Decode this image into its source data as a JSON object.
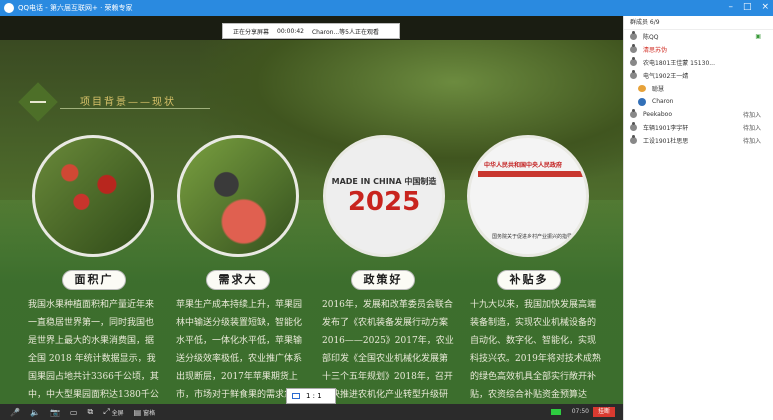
{
  "window": {
    "title": "QQ电话 - 第六届互联网+ · 荣赖专家"
  },
  "sharebar": {
    "status": "正在分享屏幕",
    "time": "00:00:42",
    "viewers": "Charon...等5人正在观看"
  },
  "slide": {
    "heading": "项目背景——现状",
    "made_in_china": "MADE IN CHINA 中国制造",
    "year": "2025",
    "gov_site": "中华人民共和国中央人民政府",
    "gov_doc": "国务院关于促进乡村产业振兴的指导意见",
    "cards": [
      {
        "label": "面积广",
        "text": "我国水果种植面积和产量近年来一直稳居世界第一，同时我国也是世界上最大的水果消费国，据全国 2018 年统计数据显示，我国果园占地共计3366千公顷，其中，中大型果园面积达1380千公顷。"
      },
      {
        "label": "需求大",
        "text": "苹果生产成本持续上升，苹果园林中输送分级装置短缺，智能化水平低，一体化水平低，苹果输送分级效率极低，农业推广体系出现断层，2017年苹果期货上市，市场对于鲜食果的需求急剧上升。"
      },
      {
        "label": "政策好",
        "text": "2016年，发展和改革委员会联合发布了《农机装备发展行动方案2016——2025》2017年，农业部印发《全国农业机械化发展第十三个五年规划》2018年，召开加快推进农机化产业转型升级研讨会。"
      },
      {
        "label": "补贴多",
        "text": "十九大以来，我国加快发展高端装备制造，实现农业机械设备的自动化、数字化、智能化，实现科技兴农。2019年将对技术成熟的绿色高效机具全部实行敞开补贴，农资综合补贴资金预算达1071亿元。"
      }
    ]
  },
  "zoom": {
    "label": "1 : 1"
  },
  "toolbar": {
    "fullscreen": "全屏",
    "share_doc": "窗格",
    "timer": "07:50",
    "end": "挂断"
  },
  "members": {
    "header": "群成员 6/9",
    "list": [
      {
        "name": "陈QQ",
        "status": ""
      },
      {
        "name": "清思苏伪",
        "status": ""
      },
      {
        "name": "农电1801王佳蒙 15130...",
        "status": ""
      },
      {
        "name": "电气1902王一婧",
        "status": ""
      },
      {
        "name": "聪慧",
        "status": ""
      },
      {
        "name": "Charon",
        "status": ""
      },
      {
        "name": "Peekaboo",
        "status": "待加入"
      },
      {
        "name": "车辆1901李宇轩",
        "status": "待加入"
      },
      {
        "name": "工设1901杜思思",
        "status": "待加入"
      }
    ]
  }
}
